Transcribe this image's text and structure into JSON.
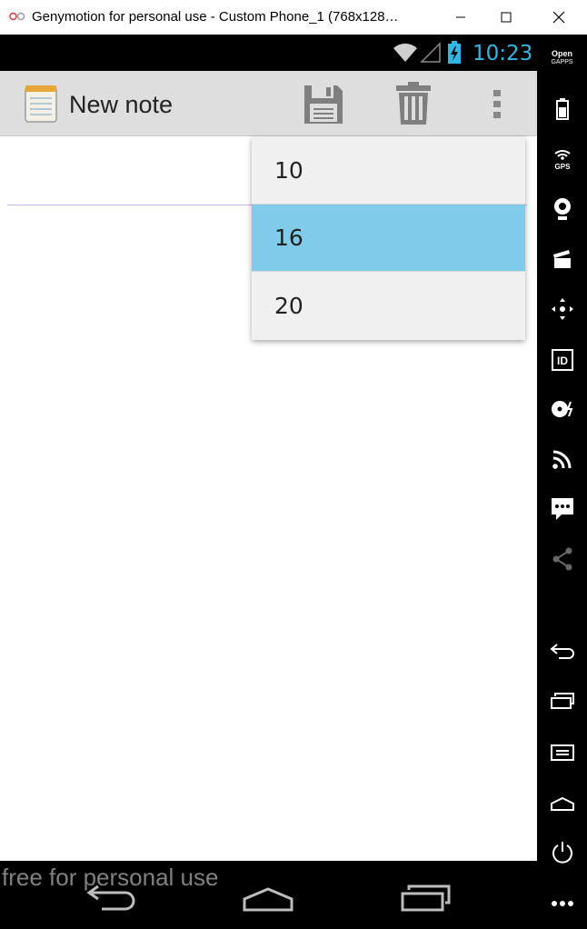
{
  "window": {
    "title": "Genymotion for personal use - Custom Phone_1 (768x128…"
  },
  "status_bar": {
    "time": "10:23",
    "accent_color": "#33b5e5"
  },
  "action_bar": {
    "title": "New note",
    "actions": [
      {
        "name": "save",
        "icon": "floppy-disk-icon"
      },
      {
        "name": "delete",
        "icon": "trash-icon"
      },
      {
        "name": "overflow",
        "icon": "overflow-menu-icon"
      }
    ]
  },
  "dropdown": {
    "options": [
      "10",
      "16",
      "20"
    ],
    "selected": "16",
    "selected_color": "#7fcbe9"
  },
  "navigation_bar": {
    "buttons": [
      "back-icon",
      "home-icon",
      "recent-apps-icon"
    ]
  },
  "watermark": "free for personal use",
  "sidebar": {
    "brand_line1": "Open",
    "brand_line2": "GAPPS",
    "gps_label": "GPS",
    "id_label": "ID",
    "items": [
      "battery-icon",
      "gps-icon",
      "webcam-icon",
      "media-clapper-icon",
      "dpad-icon",
      "id-icon",
      "disk-io-icon",
      "cast-icon",
      "sms-icon",
      "share-icon",
      "back-icon",
      "recent-apps-icon",
      "menu-icon",
      "home-icon",
      "power-icon",
      "more-icon"
    ]
  }
}
